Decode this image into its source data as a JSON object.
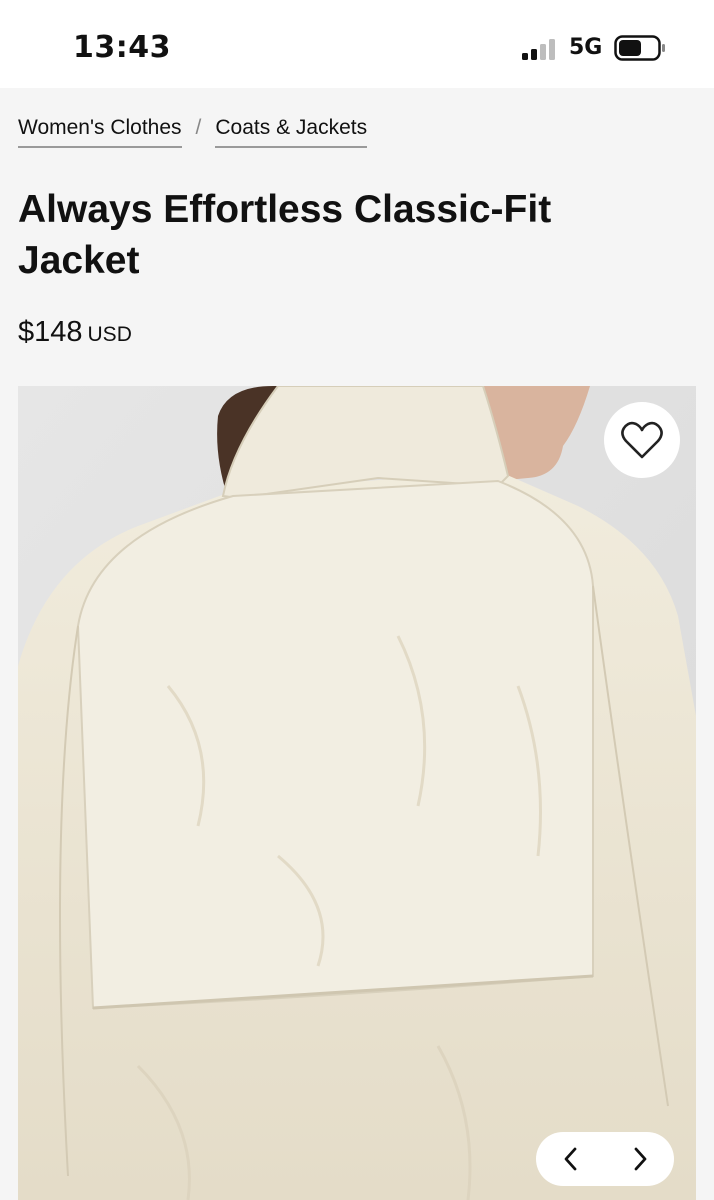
{
  "status_bar": {
    "time": "13:43",
    "network": "5G",
    "signal_bars_filled": 2,
    "signal_bars_total": 4
  },
  "breadcrumb": {
    "items": [
      {
        "label": "Women's Clothes"
      },
      {
        "label": "Coats & Jackets"
      }
    ],
    "separator": "/"
  },
  "product": {
    "title": "Always Effortless Classic-Fit Jacket",
    "price": "$148",
    "currency": "USD",
    "image_icon": "product-photo",
    "wishlist_icon": "heart-outline-icon",
    "pager_prev_icon": "chevron-left-icon",
    "pager_next_icon": "chevron-right-icon"
  },
  "colors": {
    "page_background": "#f5f5f5",
    "text": "#111111",
    "jacket": "#ede7d6"
  }
}
